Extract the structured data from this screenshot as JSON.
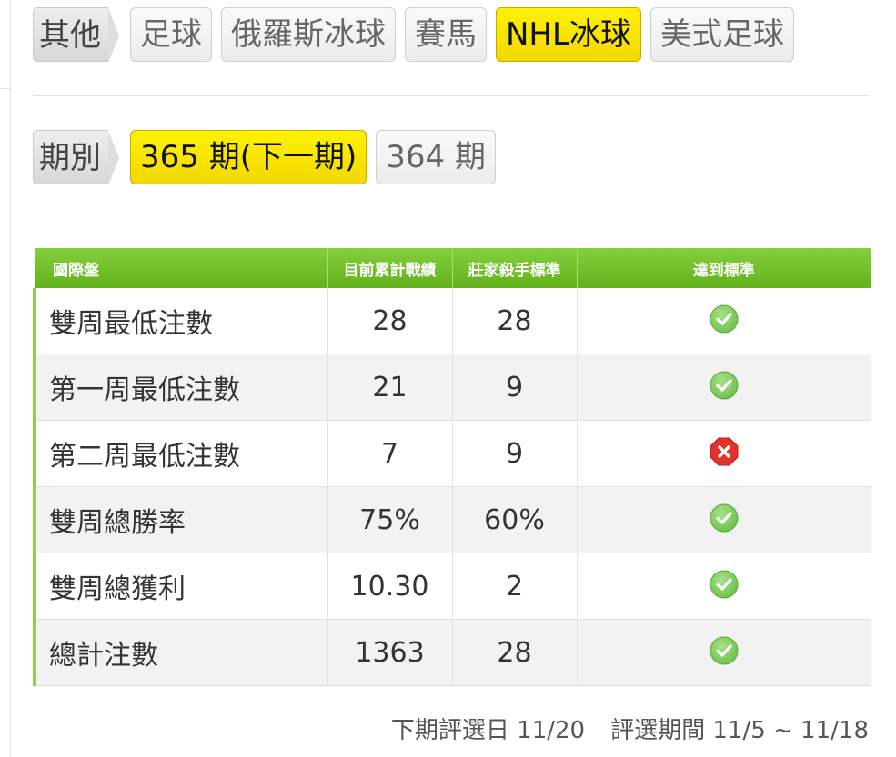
{
  "sport_tabs": {
    "label": "其他",
    "items": [
      "足球",
      "俄羅斯冰球",
      "賽馬",
      "NHL冰球",
      "美式足球"
    ],
    "active": "NHL冰球"
  },
  "period_tabs": {
    "label": "期別",
    "items": [
      "365 期(下一期)",
      "364 期"
    ],
    "active": "365 期(下一期)"
  },
  "table": {
    "headers": [
      "國際盤",
      "目前累計戰績",
      "莊家殺手標準",
      "達到標準"
    ],
    "rows": [
      {
        "label": "雙周最低注數",
        "current": "28",
        "standard": "28",
        "status": "check-icon"
      },
      {
        "label": "第一周最低注數",
        "current": "21",
        "standard": "9",
        "status": "check-icon"
      },
      {
        "label": "第二周最低注數",
        "current": "7",
        "standard": "9",
        "status": "cross-icon"
      },
      {
        "label": "雙周總勝率",
        "current": "75%",
        "standard": "60%",
        "status": "check-icon"
      },
      {
        "label": "雙周總獲利",
        "current": "10.30",
        "standard": "2",
        "status": "check-icon"
      },
      {
        "label": "總計注數",
        "current": "1363",
        "standard": "28",
        "status": "check-icon"
      }
    ]
  },
  "footer": {
    "next_selection": "下期評選日 11/20",
    "selection_period": "評選期間 11/5 ~ 11/18"
  },
  "colors": {
    "active_tab": "#fff200",
    "header_green": "#6cbf28",
    "check_green": "#6cc24a",
    "cross_red": "#e0332b"
  }
}
